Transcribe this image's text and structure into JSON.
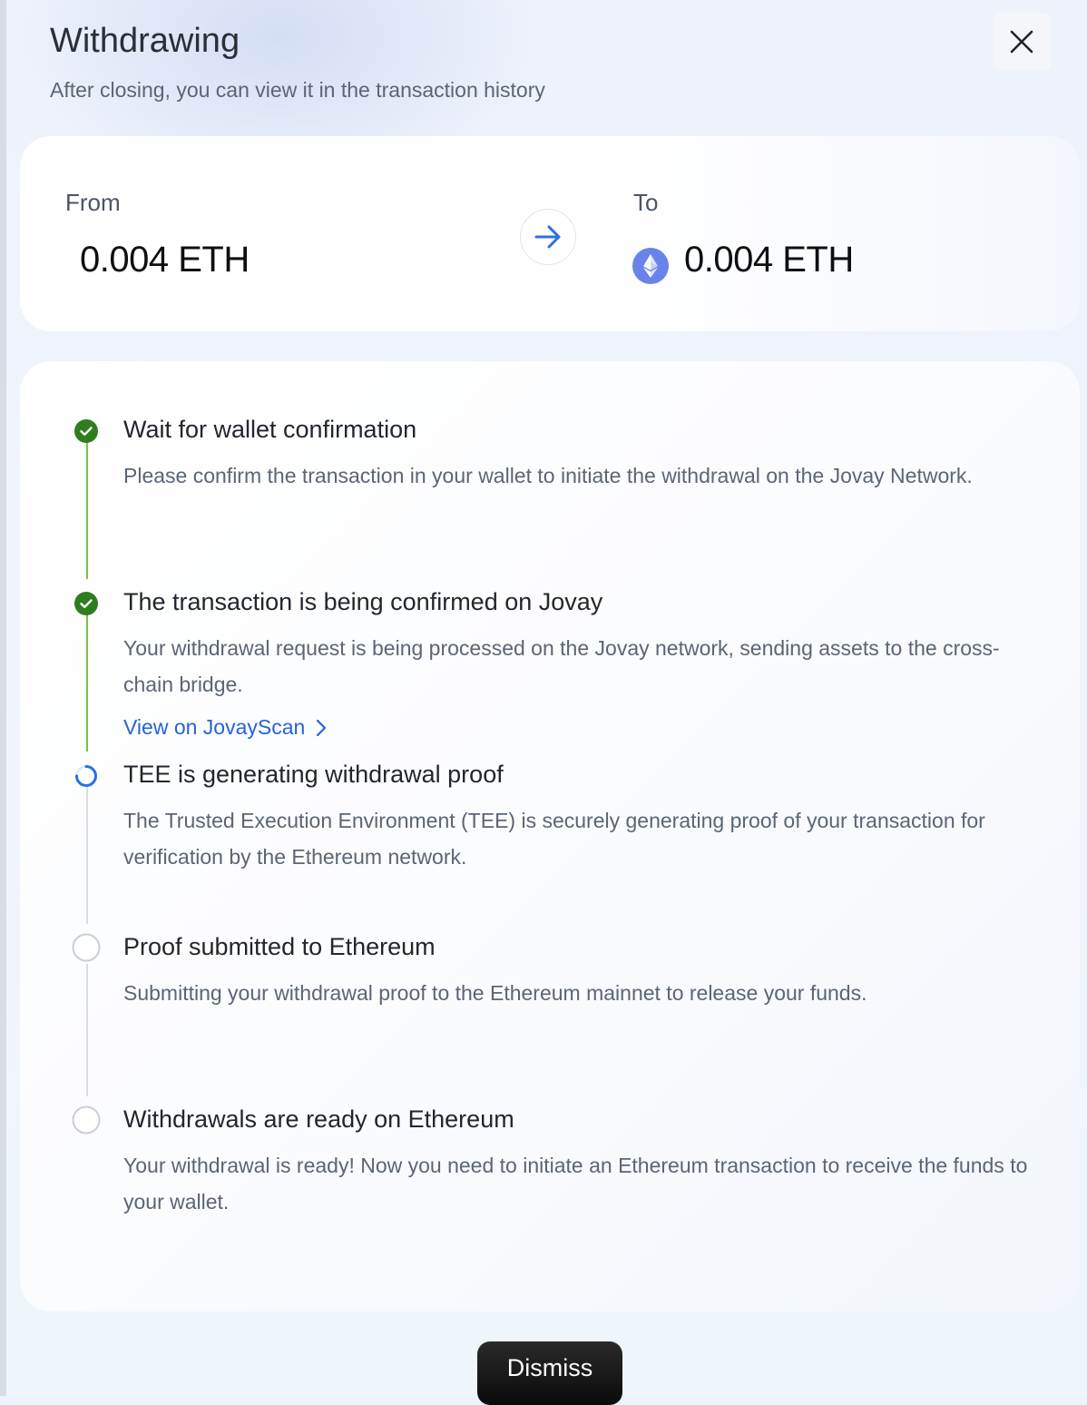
{
  "header": {
    "title": "Withdrawing",
    "subtitle": "After closing, you can view it in the transaction history"
  },
  "transfer": {
    "from_label": "From",
    "from_amount": "0.004 ETH",
    "to_label": "To",
    "to_amount": "0.004 ETH",
    "to_icon": "ethereum-icon"
  },
  "steps": [
    {
      "title": "Wait for wallet confirmation",
      "description": "Please confirm the transaction in your wallet to initiate the withdrawal on the Jovay Network.",
      "status": "completed"
    },
    {
      "title": "The transaction is being confirmed on Jovay",
      "description": "Your withdrawal request is being processed on the Jovay network, sending assets to the cross-chain bridge.",
      "status": "completed",
      "link_label": "View on JovayScan"
    },
    {
      "title": "TEE is generating withdrawal proof",
      "description": "The Trusted Execution Environment (TEE) is securely generating proof of your transaction for verification by the Ethereum network.",
      "status": "in-progress"
    },
    {
      "title": "Proof submitted to Ethereum",
      "description": "Submitting your withdrawal proof to the Ethereum mainnet to release your funds.",
      "status": "pending"
    },
    {
      "title": "Withdrawals are ready on Ethereum",
      "description": "Your withdrawal is ready! Now you need to initiate an Ethereum transaction to receive the funds to your wallet.",
      "status": "pending"
    }
  ],
  "footer": {
    "dismiss_label": "Dismiss"
  },
  "colors": {
    "completed": "#2f7d1f",
    "completed_line": "#7cc04b",
    "in_progress": "#2d6fe0",
    "link": "#2563d8",
    "pending_line": "#d9dde3"
  }
}
